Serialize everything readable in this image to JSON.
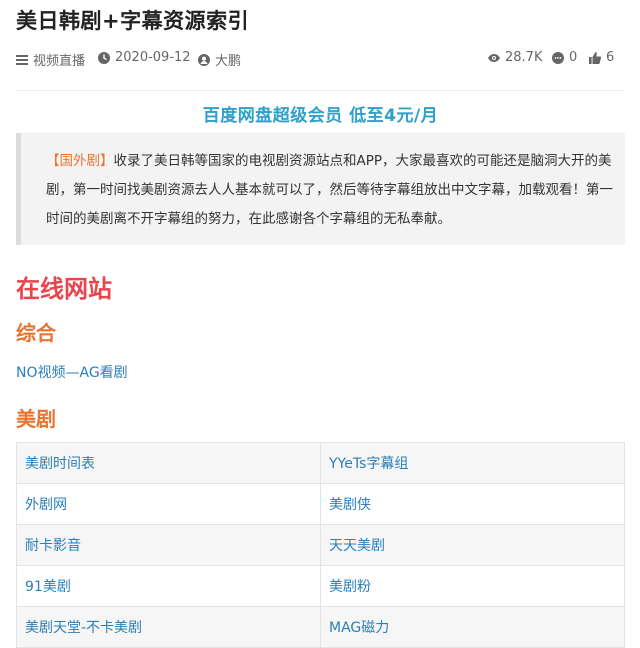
{
  "article": {
    "title": "美日韩剧+字幕资源索引",
    "meta": {
      "category": "视频直播",
      "date": "2020-09-12",
      "author": "大鹏",
      "views": "28.7K",
      "comments": "0",
      "likes": "6"
    },
    "promo": "百度网盘超级会员 低至4元/月",
    "quote": {
      "tag": "【国外剧】",
      "text": "收录了美日韩等国家的电视剧资源站点和APP，大家最喜欢的可能还是脑洞大开的美剧，第一时间找美剧资源去人人基本就可以了，然后等待字幕组放出中文字幕，加载观看！第一时间的美剧离不开字幕组的努力，在此感谢各个字幕组的无私奉献。"
    },
    "section_title": "在线网站",
    "sub1": "综合",
    "sub1_link": "NO视频—AG看剧",
    "sub2": "美剧",
    "table": [
      [
        "美剧时间表",
        "YYeTs字幕组"
      ],
      [
        "外剧网",
        "美剧侠"
      ],
      [
        "耐卡影音",
        "天天美剧"
      ],
      [
        "91美剧",
        "美剧粉"
      ],
      [
        "美剧天堂-不卡美剧",
        "MAG磁力"
      ]
    ]
  },
  "icons": {
    "category": "list-icon",
    "date": "clock-icon",
    "author": "user-icon",
    "views": "eye-icon",
    "comments": "comment-icon",
    "likes": "thumbs-up-icon"
  },
  "colors": {
    "promo": "#2fa0c9",
    "section_title": "#e8454d",
    "subheading": "#e8742f",
    "link": "#2a7fb8"
  }
}
